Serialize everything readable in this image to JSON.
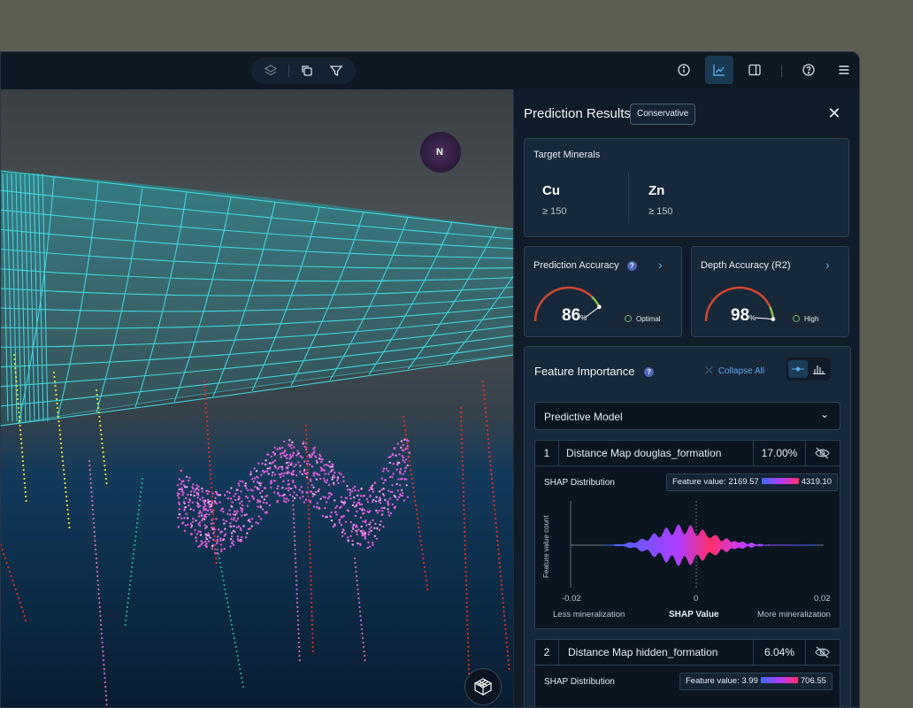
{
  "toolbar": {
    "left_tools": [
      "layers-icon",
      "copy-icon",
      "filter-icon"
    ],
    "right_tools": [
      "info-icon",
      "chart-icon",
      "sidebar-icon",
      "help-icon",
      "menu-icon"
    ]
  },
  "viewport": {
    "compass_label": "N"
  },
  "panel": {
    "title": "Prediction Results",
    "badge": "Conservative",
    "target_minerals": {
      "title": "Target Minerals",
      "items": [
        {
          "symbol": "Cu",
          "threshold": "≥ 150"
        },
        {
          "symbol": "Zn",
          "threshold": "≥ 150"
        }
      ]
    },
    "prediction_accuracy": {
      "title": "Prediction Accuracy",
      "value": "86",
      "unit": "%",
      "status": "Optimal",
      "level": 0.86
    },
    "depth_accuracy": {
      "title": "Depth Accuracy (R2)",
      "value": "98",
      "unit": "%",
      "status": "High",
      "level": 0.98
    },
    "feature_importance": {
      "title": "Feature Importance",
      "collapse_label": "Collapse All",
      "model_select": "Predictive Model",
      "features": [
        {
          "rank": "1",
          "name": "Distance Map douglas_formation",
          "pct": "17.00%",
          "shap_label": "SHAP Distribution",
          "fv_label": "Feature value:",
          "fv_min": "2169.57",
          "fv_max": "4319.10",
          "y_axis": "Feature value count",
          "x_min": "-0.02",
          "x_mid": "0",
          "x_max": "0.02",
          "left_label": "Less mineralization",
          "center_label": "SHAP Value",
          "right_label": "More mineralization"
        },
        {
          "rank": "2",
          "name": "Distance Map hidden_formation",
          "pct": "6.04%",
          "shap_label": "SHAP Distribution",
          "fv_label": "Feature value:",
          "fv_min": "3.99",
          "fv_max": "706.55"
        }
      ]
    }
  },
  "colors": {
    "accent": "#5aa7e6",
    "grid": "#3fe3e8",
    "points_pink": "#e45bd6",
    "points_yellow": "#e8e23b",
    "points_red": "#e0302e",
    "gauge_red": "#d6452d",
    "gauge_green": "#8bc34a"
  }
}
